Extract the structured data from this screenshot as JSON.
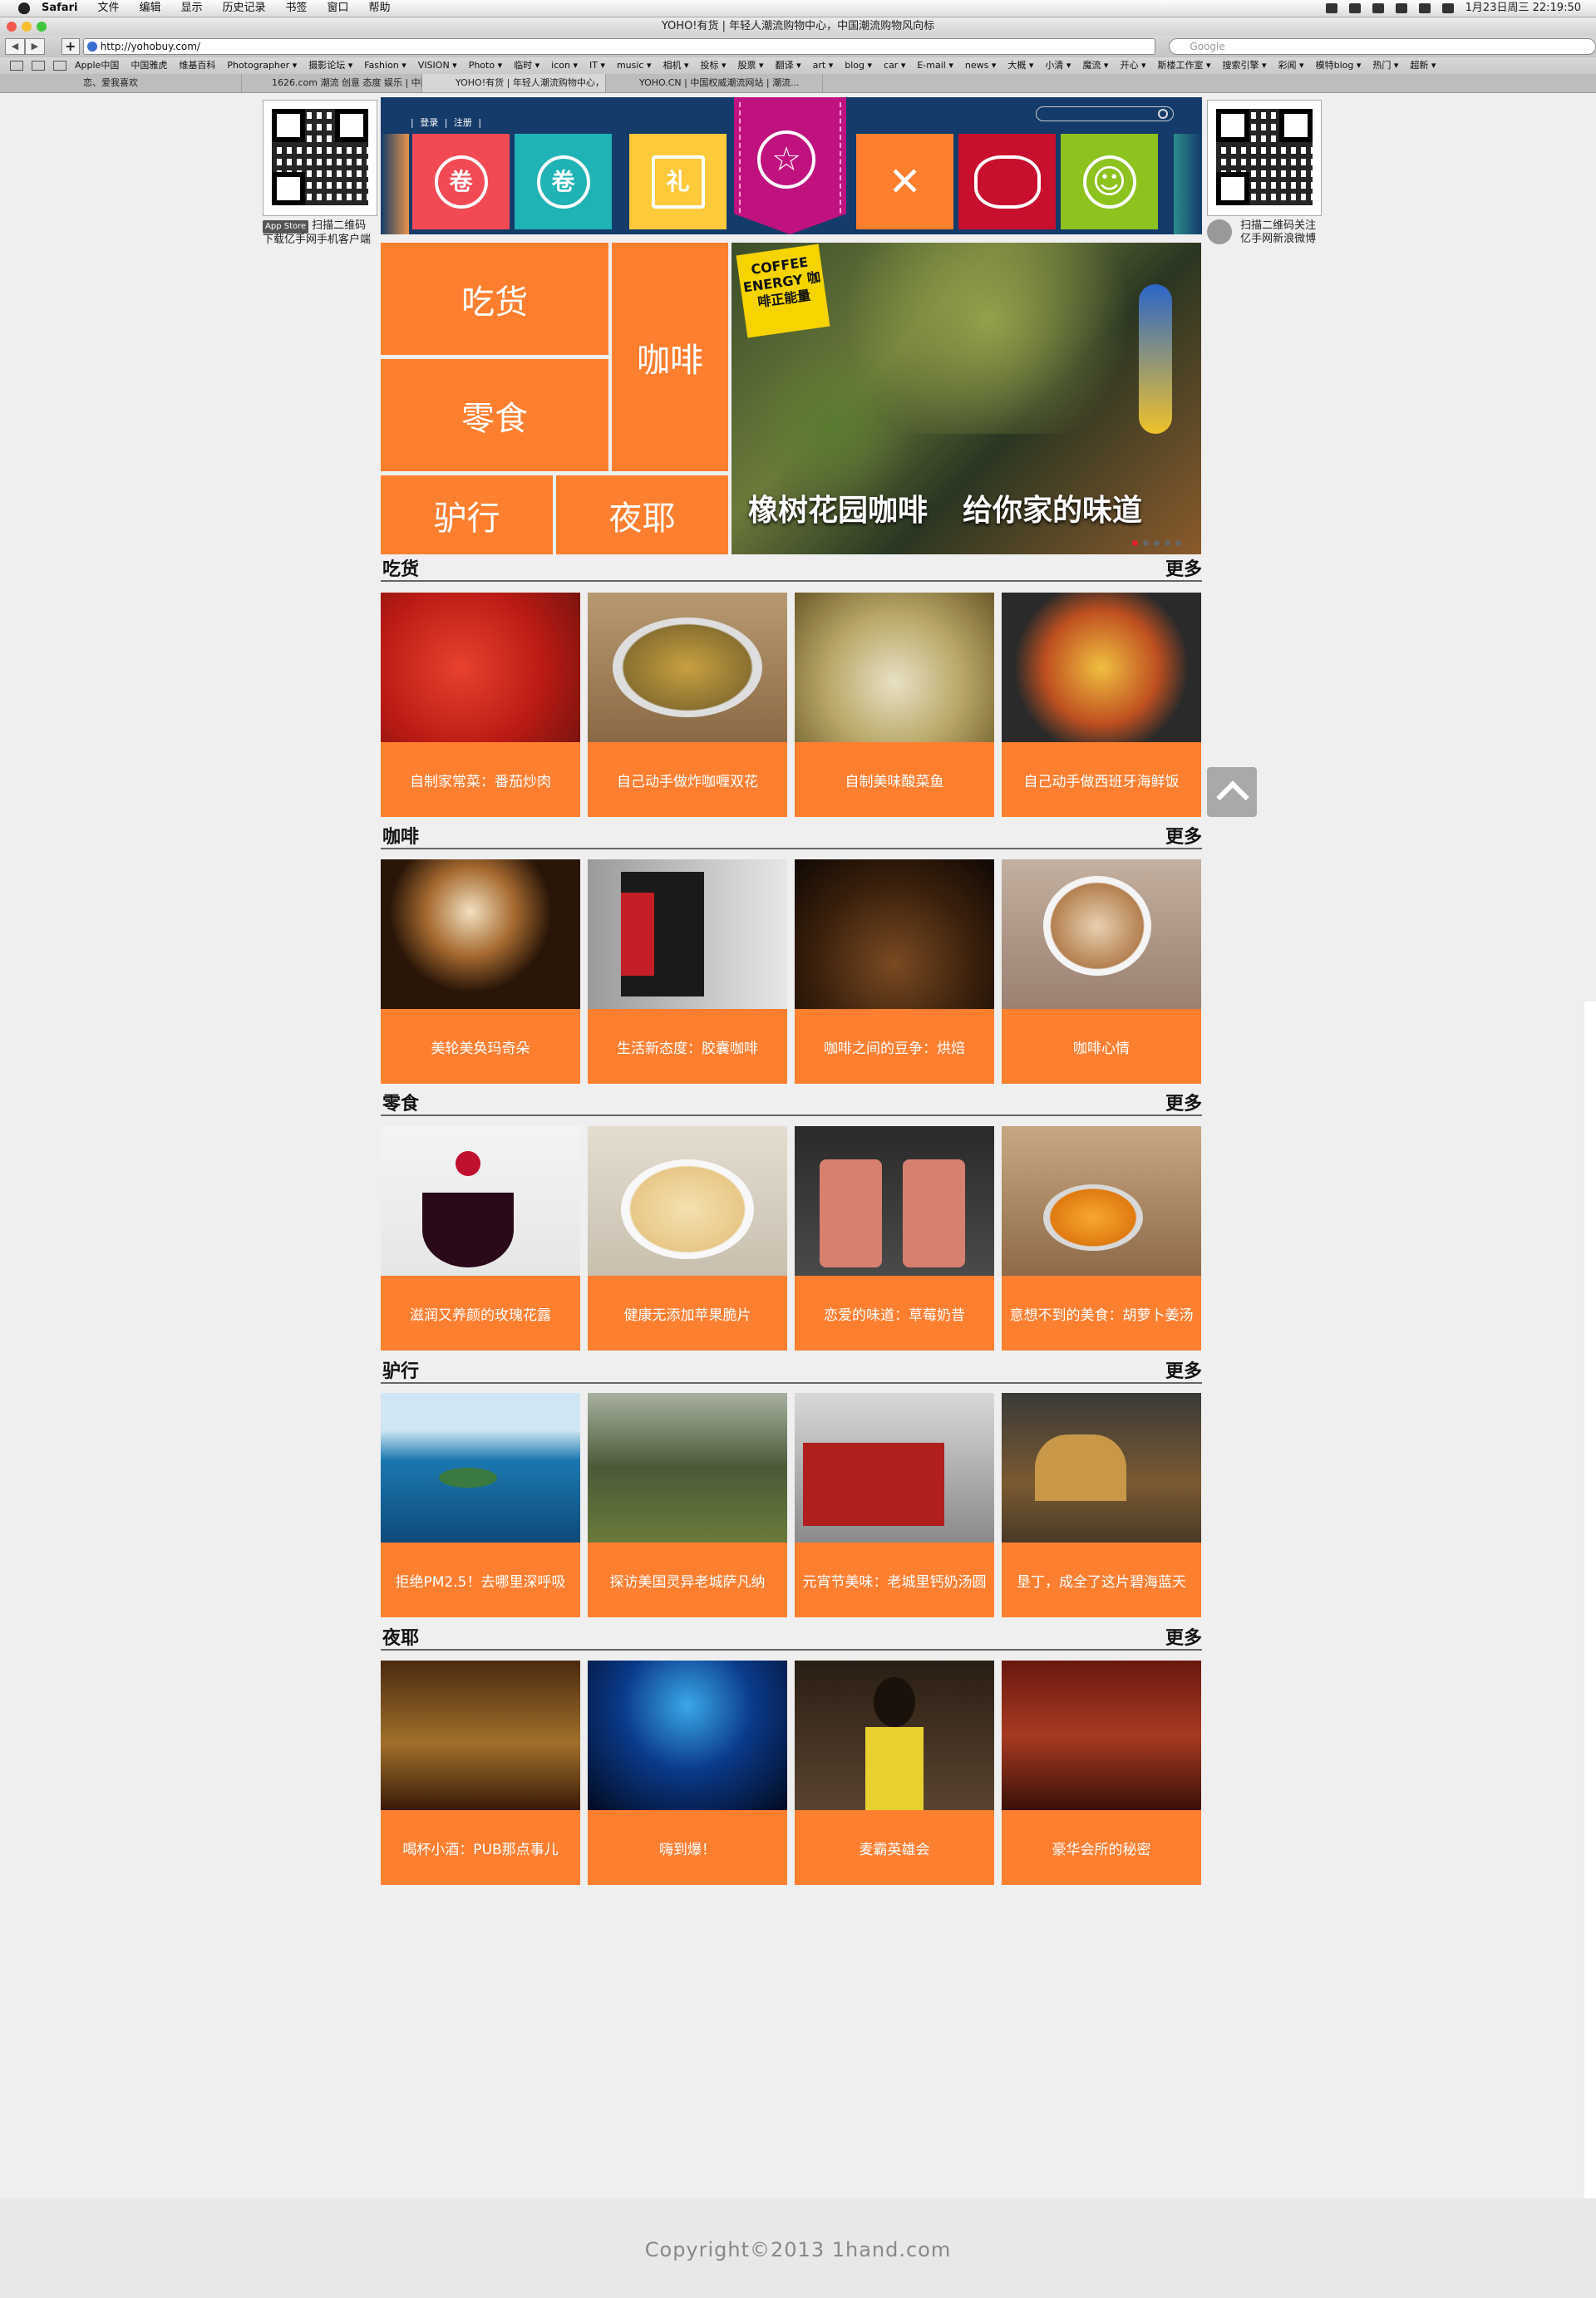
{
  "menubar": {
    "app": "Safari",
    "items": [
      "文件",
      "编辑",
      "显示",
      "历史记录",
      "书签",
      "窗口",
      "帮助"
    ],
    "clock": "1月23日周三 22:19:50"
  },
  "window": {
    "title": "YOHO!有货 | 年轻人潮流购物中心，中国潮流购物风向标"
  },
  "toolbar": {
    "url": "http://yohobuy.com/",
    "search_placeholder": "Google"
  },
  "bookmarks": [
    "Apple中国",
    "中国雅虎",
    "维基百科",
    "Photographer ▾",
    "摄影论坛 ▾",
    "Fashion ▾",
    "VISION ▾",
    "Photo ▾",
    "临时 ▾",
    "icon ▾",
    "IT ▾",
    "music ▾",
    "相机 ▾",
    "投标 ▾",
    "股票 ▾",
    "翻译 ▾",
    "art ▾",
    "blog ▾",
    "car ▾",
    "E-mail ▾",
    "news ▾",
    "大概 ▾",
    "小清 ▾",
    "魔流 ▾",
    "开心 ▾",
    "斯楼工作室 ▾",
    "搜索引擎 ▾",
    "彩闻 ▾",
    "模特blog ▾",
    "热门 ▾",
    "超新 ▾"
  ],
  "tabs": [
    "恋、爱我喜欢",
    "1626.com 潮流 创意 态度 娱乐 | 中国...",
    "YOHO!有货 | 年轻人潮流购物中心，...",
    "YOHO.CN | 中国权威潮流网站 | 潮流..."
  ],
  "qr_left": {
    "badge": "App Store",
    "line1": "扫描二维码",
    "line2": "下载亿手网手机客户端"
  },
  "qr_right": {
    "line1": "扫描二维码关注",
    "line2": "亿手网新浪微博"
  },
  "header": {
    "login": "登录",
    "register": "注册",
    "nav": [
      {
        "icon": "female-ticket-icon",
        "glyph": "卷",
        "color": "#f24a55"
      },
      {
        "icon": "male-ticket-icon",
        "glyph": "卷",
        "color": "#1fb3b5"
      },
      {
        "icon": "gift-icon",
        "glyph": "礼",
        "color": "#ffc93c"
      },
      {
        "icon": "star-icon",
        "glyph": "☆",
        "color": "#c0127f"
      },
      {
        "icon": "fork-knife-icon",
        "glyph": "✕",
        "color": "#ff7f30"
      },
      {
        "icon": "speech-bubble-icon",
        "glyph": "◯",
        "color": "#c8102e"
      },
      {
        "icon": "smiley-icon",
        "glyph": "☺",
        "color": "#8dc21f"
      }
    ]
  },
  "categories": {
    "eat": "吃货",
    "coffee": "咖啡",
    "snack": "零食",
    "travel": "驴行",
    "night": "夜耶"
  },
  "hero": {
    "badge": "COFFEE ENERGY 咖啡正能量",
    "caption1": "橡树花园咖啡",
    "caption2": "给你家的味道"
  },
  "sections": [
    {
      "title": "吃货",
      "more": "更多",
      "items": [
        "自制家常菜：番茄炒肉",
        "自己动手做炸咖喱双花",
        "自制美味酸菜鱼",
        "自己动手做西班牙海鲜饭"
      ]
    },
    {
      "title": "咖啡",
      "more": "更多",
      "items": [
        "美轮美奂玛奇朵",
        "生活新态度：胶囊咖啡",
        "咖啡之间的豆争：烘焙",
        "咖啡心情"
      ]
    },
    {
      "title": "零食",
      "more": "更多",
      "items": [
        "滋润又养颜的玫瑰花露",
        "健康无添加苹果脆片",
        "恋爱的味道：草莓奶昔",
        "意想不到的美食：胡萝卜姜汤"
      ]
    },
    {
      "title": "驴行",
      "more": "更多",
      "items": [
        "拒绝PM2.5！去哪里深呼吸",
        "探访美国灵异老城萨凡纳",
        "元宵节美味：老城里钙奶汤圆",
        "垦丁，成全了这片碧海蓝天"
      ]
    },
    {
      "title": "夜耶",
      "more": "更多",
      "items": [
        "喝杯小酒：PUB那点事儿",
        "嗨到爆！",
        "麦霸英雄会",
        "豪华会所的秘密"
      ]
    }
  ],
  "footer": {
    "copyright": "Copyright©2013 1hand.com"
  }
}
